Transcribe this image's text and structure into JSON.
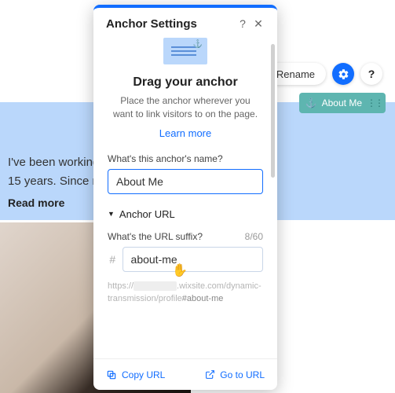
{
  "colors": {
    "accent": "#116dff",
    "bgblue": "#bad7fb",
    "teal": "#5eb5b0"
  },
  "background": {
    "body_line": "I've been working",
    "body_line2": "15 years. Since m",
    "readmore": "Read more"
  },
  "toolbar": {
    "rename": "Rename",
    "gear_icon": "gear-icon",
    "help": "?"
  },
  "anchor_tag": {
    "icon": "⚓",
    "label": "About Me"
  },
  "modal": {
    "title": "Anchor Settings",
    "help": "?",
    "close": "✕",
    "heading": "Drag your anchor",
    "sub": "Place the anchor wherever you want to link visitors to on the page.",
    "learn": "Learn more",
    "name_label": "What's this anchor's name?",
    "name_value": "About Me",
    "section": "Anchor URL",
    "suffix_label": "What's the URL suffix?",
    "suffix_count": "8/60",
    "hash": "#",
    "suffix_value": "about-me",
    "url_pre": "https://",
    "url_blur": "xxxxxxxxxx",
    "url_mid": ".wixsite.com/dynamic-transmission/profile",
    "url_frag": "#about-me",
    "copy": "Copy URL",
    "goto": "Go to URL"
  }
}
